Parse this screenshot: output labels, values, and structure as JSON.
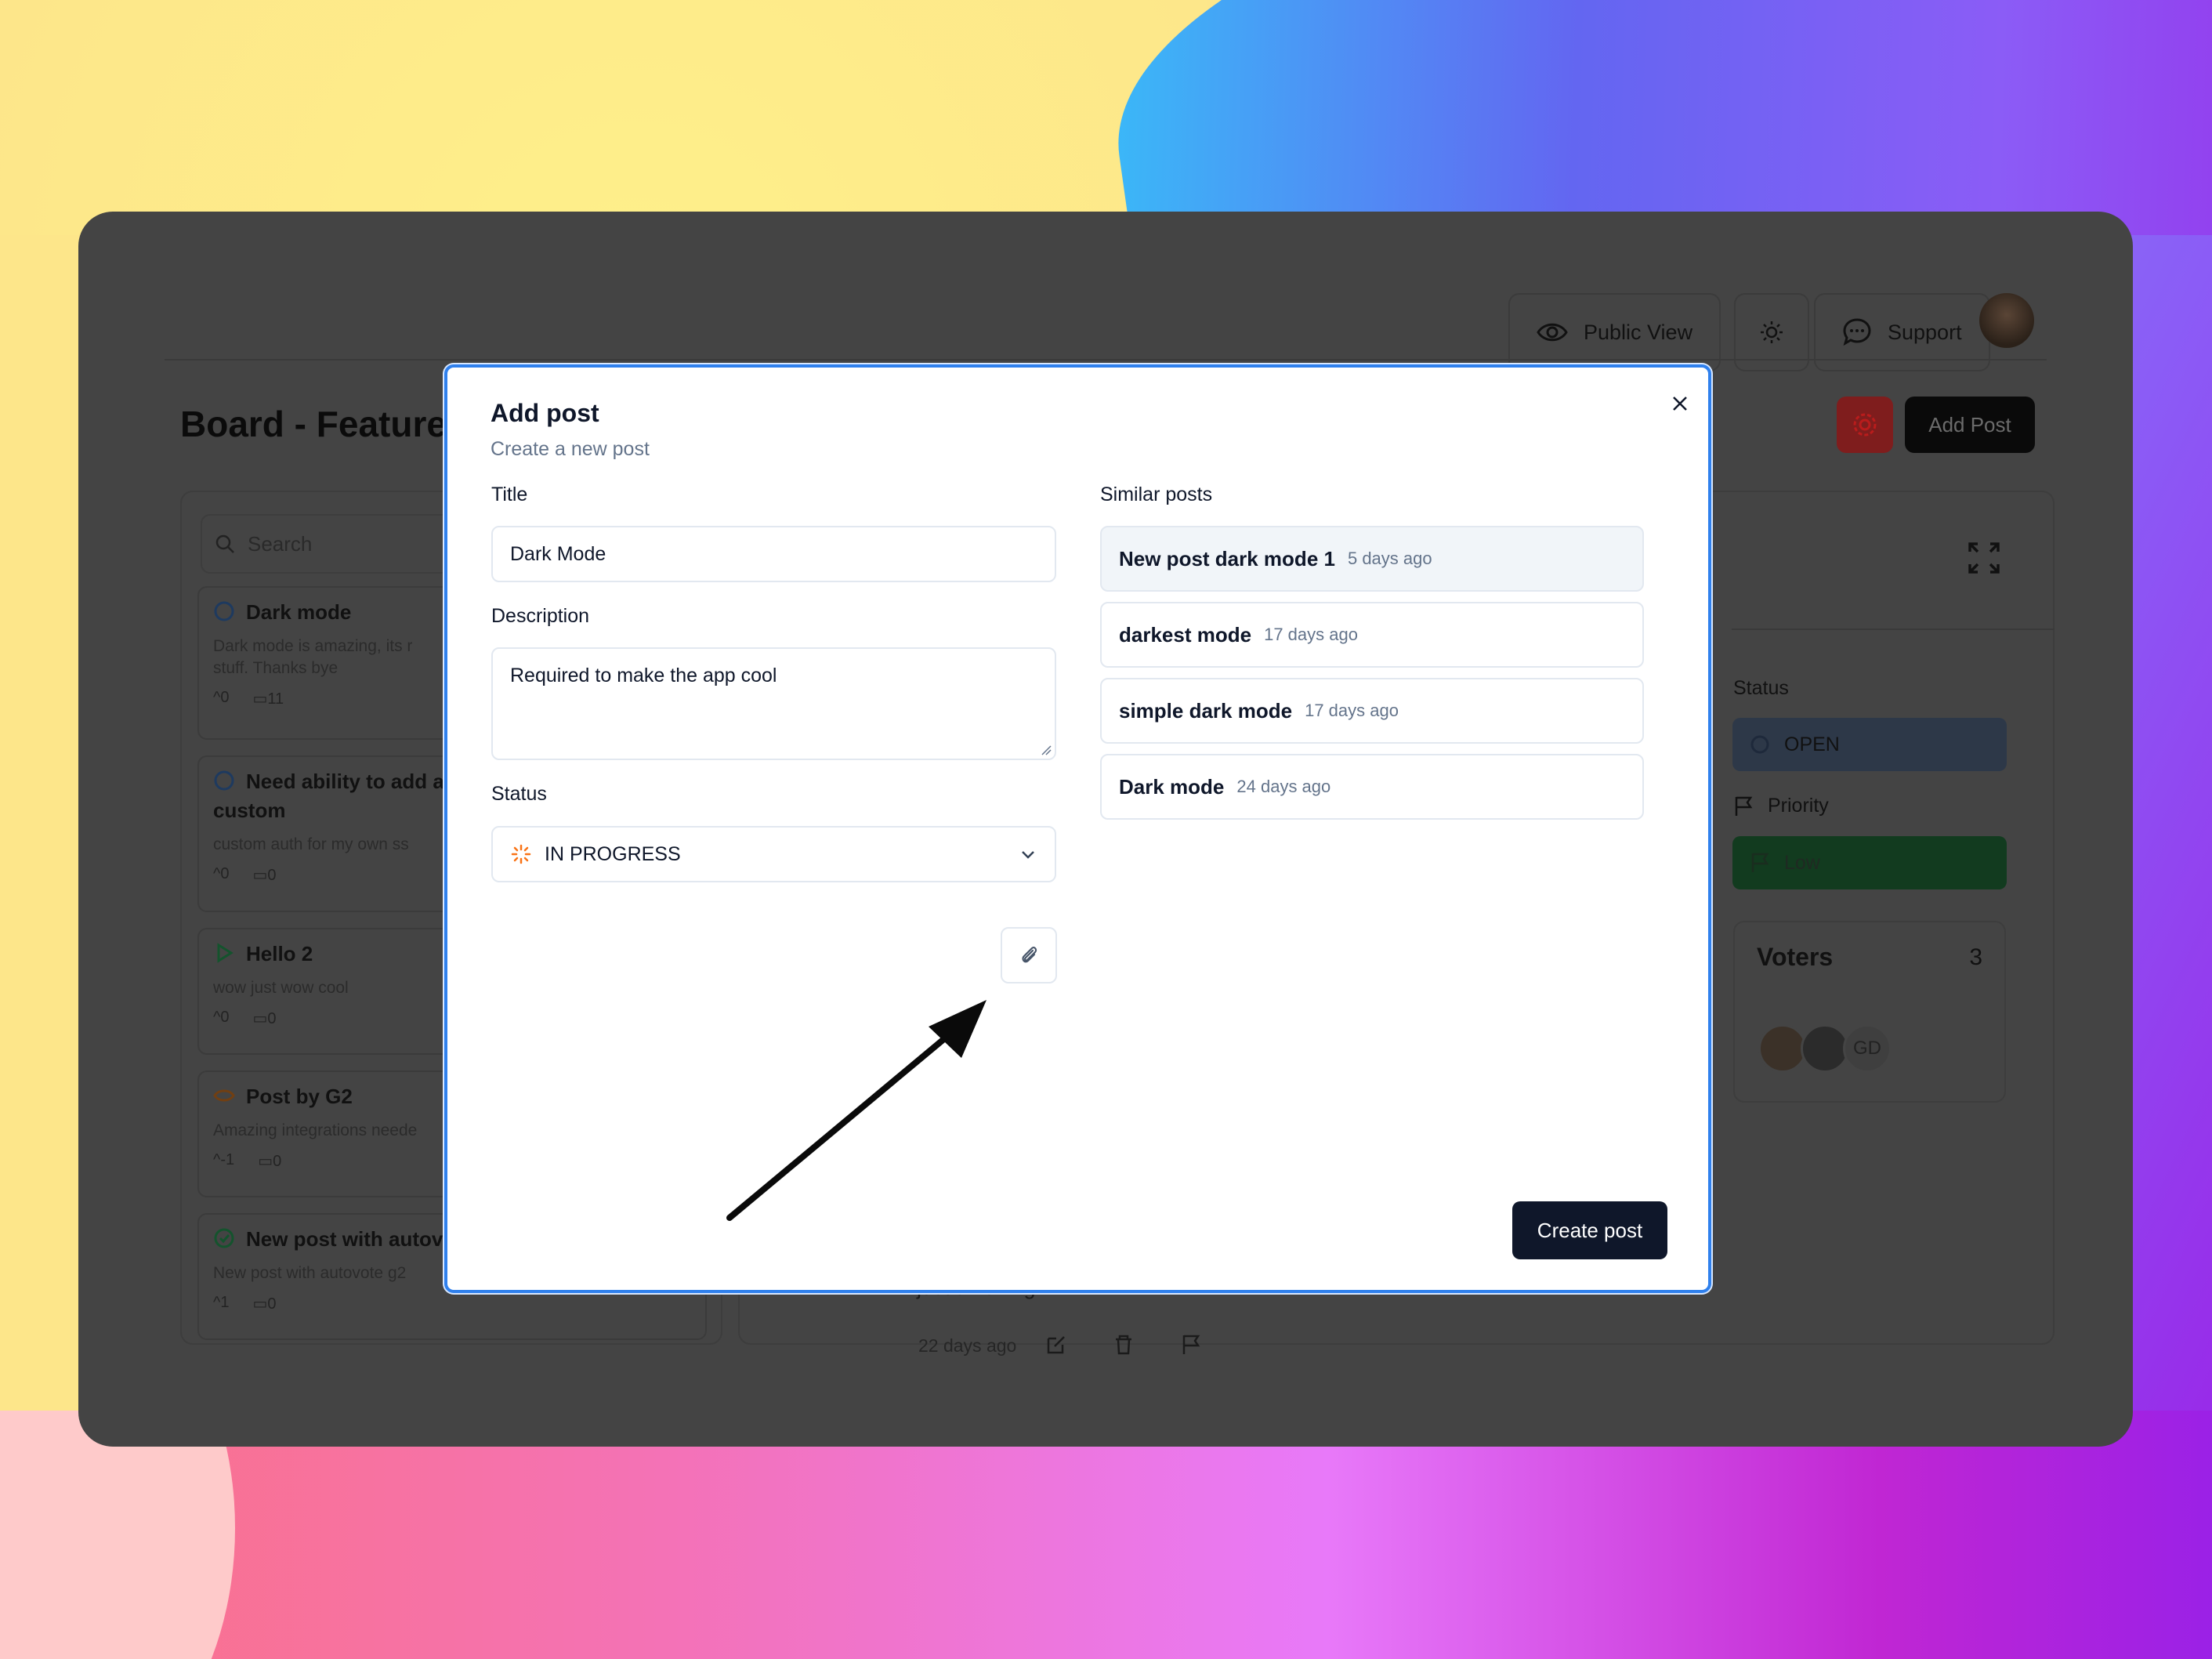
{
  "header": {
    "public_view": "Public View",
    "support": "Support"
  },
  "board": {
    "title": "Board - Features",
    "add_post": "Add Post",
    "search_placeholder": "Search"
  },
  "posts": [
    {
      "title": "Dark mode",
      "desc": "Dark mode is amazing, its r",
      "desc2": "stuff. Thanks bye",
      "votes": "0",
      "comments": "11"
    },
    {
      "title": "Need ability to add a",
      "title2": "custom",
      "desc": "custom auth for my own ss",
      "votes": "0",
      "comments": "0"
    },
    {
      "title": "Hello 2",
      "desc": "wow just wow cool",
      "votes": "0",
      "comments": "0"
    },
    {
      "title": "Post by G2",
      "desc": "Amazing integrations neede",
      "votes": "-1",
      "comments": "0"
    },
    {
      "title": "New post with autov",
      "desc": "New post with autovote g2",
      "votes": "1",
      "comments": "0"
    }
  ],
  "side": {
    "status_label": "Status",
    "status_value": "OPEN",
    "priority_label": "Priority",
    "priority_value": "Low",
    "voters_label": "Voters",
    "voters_count": "3",
    "voter_initials": "GD"
  },
  "detail": {
    "body_fragment": "just amazing",
    "time": "22 days ago"
  },
  "modal": {
    "title": "Add post",
    "subtitle": "Create a new post",
    "title_label": "Title",
    "title_value": "Dark Mode",
    "description_label": "Description",
    "description_value": "Required to make the app cool",
    "status_label": "Status",
    "status_value": "IN PROGRESS",
    "similar_label": "Similar posts",
    "similar": [
      {
        "name": "New post dark mode 1",
        "age": "5 days ago"
      },
      {
        "name": "darkest mode",
        "age": "17 days ago"
      },
      {
        "name": "simple dark mode",
        "age": "17 days ago"
      },
      {
        "name": "Dark mode",
        "age": "24 days ago"
      }
    ],
    "create_button": "Create post"
  },
  "colors": {
    "modal_border": "#2f80ed",
    "primary": "#0f172a",
    "in_progress": "#f97316"
  }
}
